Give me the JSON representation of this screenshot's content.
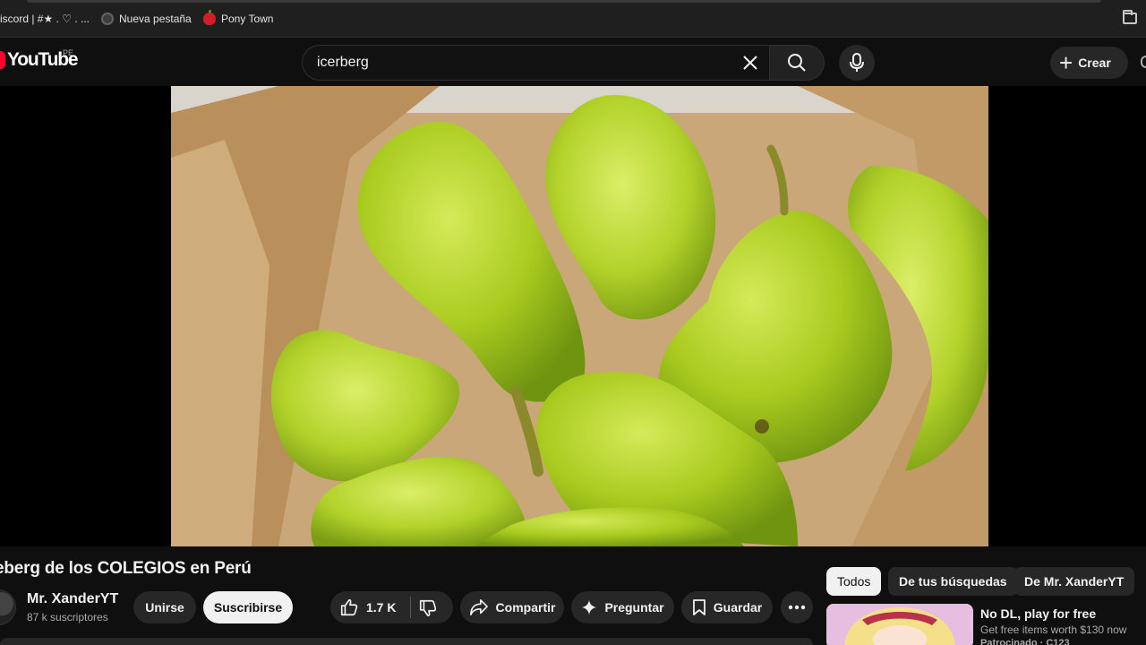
{
  "bookmarks": [
    {
      "label": "iscord | #★ . ♡ . ...",
      "icon": "discord-icon"
    },
    {
      "label": "Nueva pestaña",
      "icon": "globe-icon"
    },
    {
      "label": "Pony Town",
      "icon": "apple-icon"
    }
  ],
  "masthead": {
    "logo": "YouTube",
    "region": "PE",
    "search_value": "icerberg",
    "create_label": "Crear"
  },
  "video": {
    "title": "eberg de los COLEGIOS en Perú",
    "channel": "Mr. XanderYT",
    "subscribers": "87 k suscriptores",
    "join_label": "Unirse",
    "subscribe_label": "Suscribirse",
    "likes": "1.7 K",
    "share_label": "Compartir",
    "ask_label": "Preguntar",
    "save_label": "Guardar"
  },
  "chips": [
    "Todos",
    "De tus búsquedas",
    "De Mr. XanderYT"
  ],
  "recommendation": {
    "title": "No DL, play for free",
    "description": "Get free items worth $130 now",
    "sponsor": "Patrocinado · C123"
  },
  "colors": {
    "accent": "#ff0033",
    "background": "#0f0f0f",
    "pill": "#272727"
  }
}
